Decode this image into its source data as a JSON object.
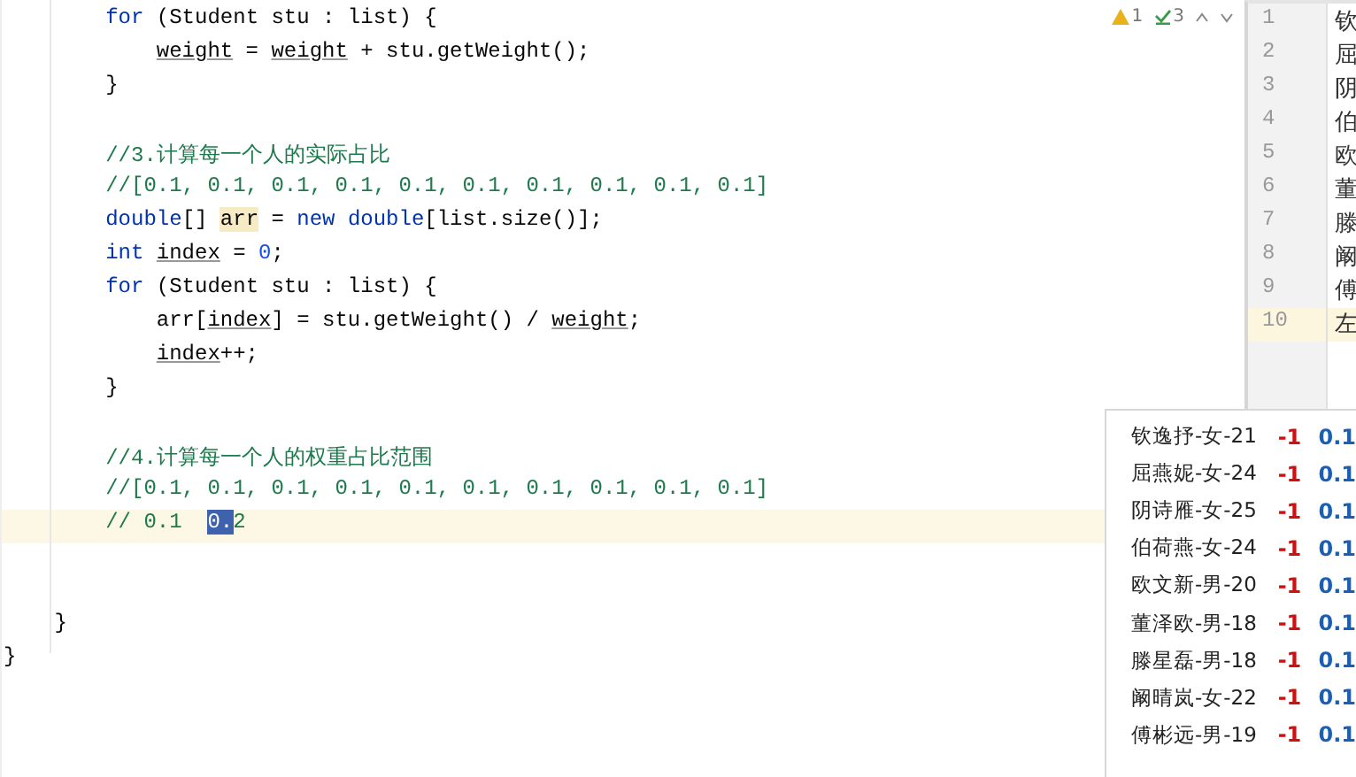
{
  "editor": {
    "status": {
      "warnings": "1",
      "checks": "3"
    },
    "lines": [
      {
        "kind": "group",
        "children": [
          {
            "kind": "group",
            "children": [
              {
                "kind": "code",
                "current": false,
                "segments": [
                  {
                    "text": "for",
                    "kind": "kw"
                  },
                  {
                    "text": " (Student stu : list) {",
                    "kind": "plain"
                  }
                ],
                "children": [
                  {
                    "kind": "code",
                    "current": false,
                    "segments": [
                      {
                        "text": "weight",
                        "kind": "var"
                      },
                      {
                        "text": " = ",
                        "kind": "plain"
                      },
                      {
                        "text": "weight",
                        "kind": "var"
                      },
                      {
                        "text": " + stu.getWeight();",
                        "kind": "plain"
                      }
                    ]
                  }
                ]
              },
              {
                "kind": "code",
                "current": false,
                "segments": [
                  {
                    "text": "}",
                    "kind": "plain"
                  }
                ]
              },
              {
                "kind": "blank"
              },
              {
                "kind": "code",
                "current": false,
                "segments": [
                  {
                    "text": "//3.计算每一个人的实际占比",
                    "kind": "comment"
                  }
                ]
              },
              {
                "kind": "code",
                "current": false,
                "segments": [
                  {
                    "text": "//[0.1, 0.1, 0.1, 0.1, 0.1, 0.1, 0.1, 0.1, 0.1, 0.1]",
                    "kind": "comment"
                  }
                ]
              },
              {
                "kind": "code",
                "current": false,
                "segments": [
                  {
                    "text": "double",
                    "kind": "kw"
                  },
                  {
                    "text": "[] ",
                    "kind": "plain"
                  },
                  {
                    "text": "arr",
                    "kind": "hl"
                  },
                  {
                    "text": " = ",
                    "kind": "plain"
                  },
                  {
                    "text": "new double",
                    "kind": "kw"
                  },
                  {
                    "text": "[list.size()];",
                    "kind": "plain"
                  }
                ]
              },
              {
                "kind": "code",
                "current": false,
                "segments": [
                  {
                    "text": "int ",
                    "kind": "kw"
                  },
                  {
                    "text": "index",
                    "kind": "var"
                  },
                  {
                    "text": " = ",
                    "kind": "plain"
                  },
                  {
                    "text": "0",
                    "kind": "num"
                  },
                  {
                    "text": ";",
                    "kind": "plain"
                  }
                ]
              },
              {
                "kind": "code",
                "current": false,
                "segments": [
                  {
                    "text": "for",
                    "kind": "kw"
                  },
                  {
                    "text": " (Student stu : list) {",
                    "kind": "plain"
                  }
                ],
                "children": [
                  {
                    "kind": "code",
                    "current": false,
                    "segments": [
                      {
                        "text": "arr[",
                        "kind": "plain"
                      },
                      {
                        "text": "index",
                        "kind": "var"
                      },
                      {
                        "text": "] = stu.getWeight() / ",
                        "kind": "plain"
                      },
                      {
                        "text": "weight",
                        "kind": "var"
                      },
                      {
                        "text": ";",
                        "kind": "plain"
                      }
                    ]
                  },
                  {
                    "kind": "code",
                    "current": false,
                    "segments": [
                      {
                        "text": "index",
                        "kind": "var"
                      },
                      {
                        "text": "++;",
                        "kind": "plain"
                      }
                    ]
                  }
                ]
              },
              {
                "kind": "code",
                "current": false,
                "segments": [
                  {
                    "text": "}",
                    "kind": "plain"
                  }
                ]
              },
              {
                "kind": "blank"
              },
              {
                "kind": "code",
                "current": false,
                "segments": [
                  {
                    "text": "//4.计算每一个人的权重占比范围",
                    "kind": "comment"
                  }
                ]
              },
              {
                "kind": "code",
                "current": false,
                "segments": [
                  {
                    "text": "//[0.1, 0.1, 0.1, 0.1, 0.1, 0.1, 0.1, 0.1, 0.1, 0.1]",
                    "kind": "comment"
                  }
                ]
              },
              {
                "kind": "code",
                "current": true,
                "segments": [
                  {
                    "text": "// 0.1  ",
                    "kind": "comment"
                  },
                  {
                    "text": "0.",
                    "kind": "sel"
                  },
                  {
                    "text": "2",
                    "kind": "comment"
                  }
                ]
              },
              {
                "kind": "blank"
              },
              {
                "kind": "blank"
              }
            ]
          },
          {
            "kind": "code",
            "current": false,
            "segments": [
              {
                "text": "}",
                "kind": "plain"
              }
            ]
          }
        ]
      },
      {
        "kind": "code",
        "current": false,
        "segments": [
          {
            "text": "}",
            "kind": "plain"
          }
        ]
      }
    ]
  },
  "file_panel": {
    "lines": [
      {
        "number": "1",
        "text": "钦",
        "current": false
      },
      {
        "number": "2",
        "text": "屈",
        "current": false
      },
      {
        "number": "3",
        "text": "阴",
        "current": false
      },
      {
        "number": "4",
        "text": "伯",
        "current": false
      },
      {
        "number": "5",
        "text": "欧",
        "current": false
      },
      {
        "number": "6",
        "text": "董",
        "current": false
      },
      {
        "number": "7",
        "text": "滕",
        "current": false
      },
      {
        "number": "8",
        "text": "阚",
        "current": false
      },
      {
        "number": "9",
        "text": "傅",
        "current": false
      },
      {
        "number": "10",
        "text": "左",
        "current": true
      }
    ]
  },
  "popup": {
    "rows": [
      {
        "name": "钦逸抒-女-21",
        "delta": "-1",
        "value": "0.1"
      },
      {
        "name": "屈燕妮-女-24",
        "delta": "-1",
        "value": "0.1"
      },
      {
        "name": "阴诗雁-女-25",
        "delta": "-1",
        "value": "0.1"
      },
      {
        "name": "伯荷燕-女-24",
        "delta": "-1",
        "value": "0.1"
      },
      {
        "name": "欧文新-男-20",
        "delta": "-1",
        "value": "0.1"
      },
      {
        "name": "董泽欧-男-18",
        "delta": "-1",
        "value": "0.1"
      },
      {
        "name": "滕星磊-男-18",
        "delta": "-1",
        "value": "0.1"
      },
      {
        "name": "阚晴岚-女-22",
        "delta": "-1",
        "value": "0.1"
      },
      {
        "name": "傅彬远-男-19",
        "delta": "-1",
        "value": "0.1"
      }
    ]
  }
}
